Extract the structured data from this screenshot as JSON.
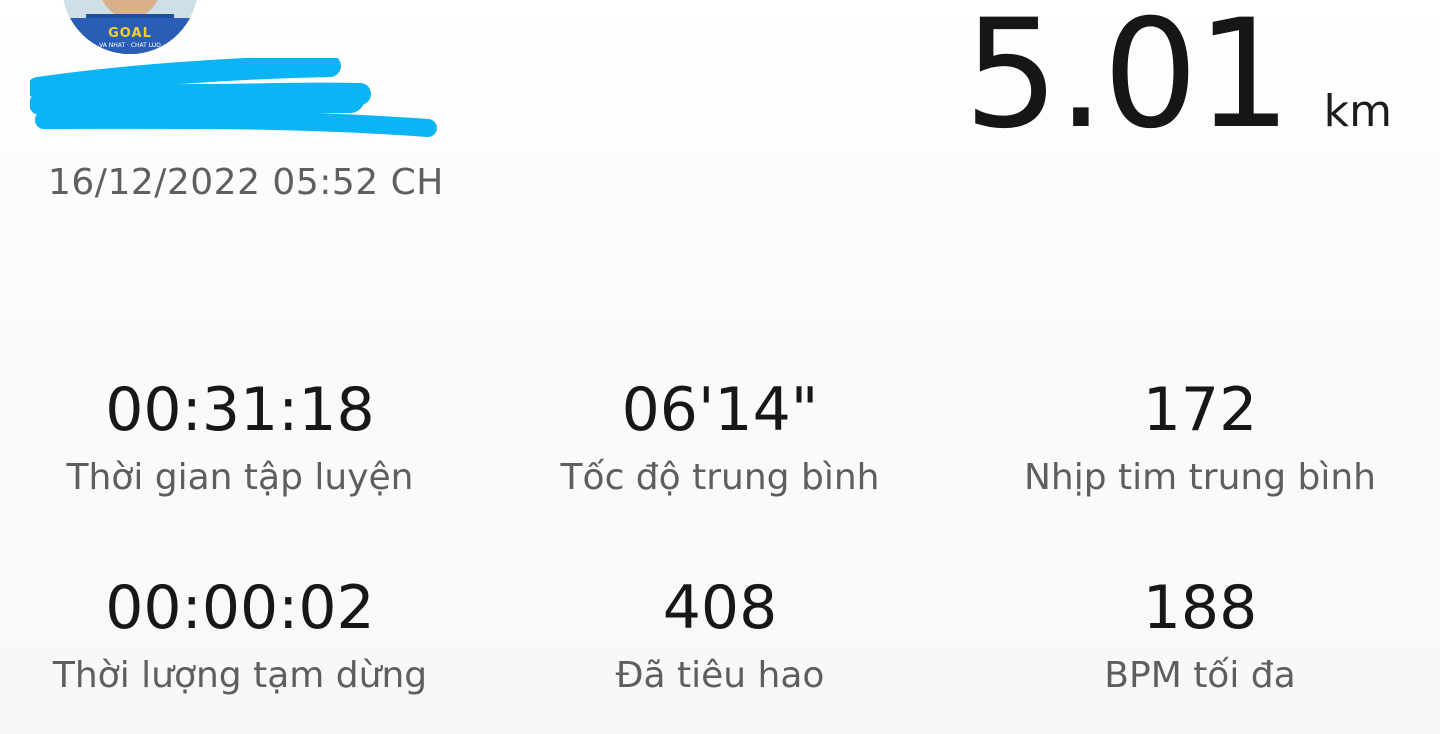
{
  "profile": {
    "avatar_badge_text": "GOAL",
    "avatar_motto": "VA NHAT · CHAT LUO",
    "name_redacted": true,
    "workout_datetime": "16/12/2022 05:52 CH"
  },
  "summary": {
    "distance_value": "5.01",
    "distance_unit": "km"
  },
  "stats": [
    {
      "value": "00:31:18",
      "label": "Thời gian tập luyện"
    },
    {
      "value": "06'14\"",
      "label": "Tốc độ trung bình"
    },
    {
      "value": "172",
      "label": "Nhịp tim trung bình"
    },
    {
      "value": "00:00:02",
      "label": "Thời lượng tạm dừng"
    },
    {
      "value": "408",
      "label": "Đã tiêu hao"
    },
    {
      "value": "188",
      "label": "BPM tối đa"
    }
  ],
  "colors": {
    "redaction": "#0ab4f5",
    "value_text": "#171717",
    "label_text": "#5e5e5e"
  }
}
